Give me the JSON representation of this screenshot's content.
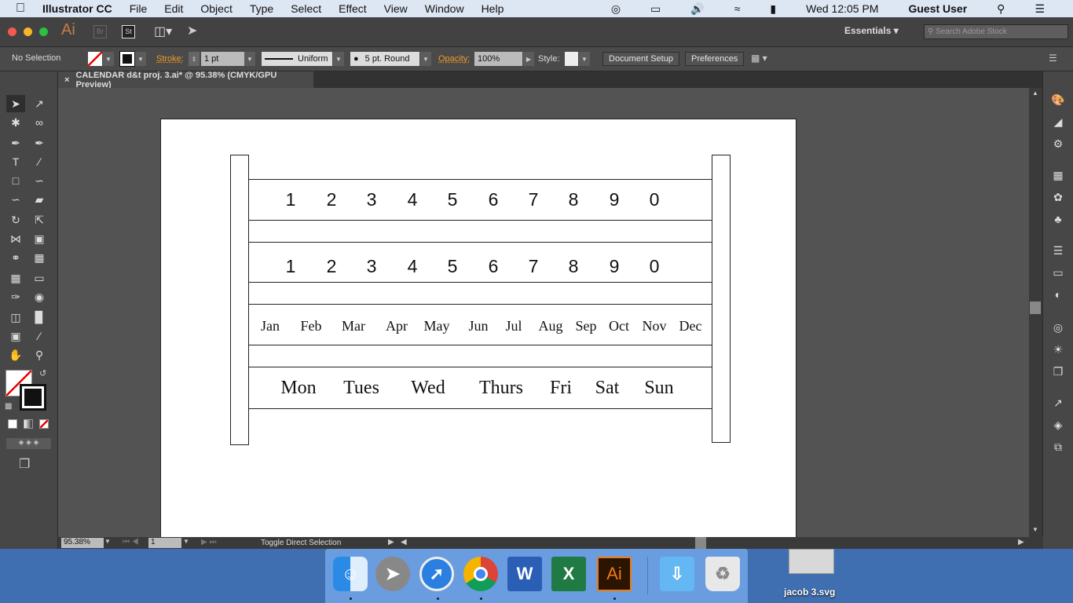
{
  "menubar": {
    "app": "Illustrator CC",
    "items": [
      "File",
      "Edit",
      "Object",
      "Type",
      "Select",
      "Effect",
      "View",
      "Window",
      "Help"
    ],
    "clock": "Wed 12:05 PM",
    "user": "Guest User"
  },
  "appbar": {
    "logo": "Ai",
    "bridge": "Br",
    "stock": "St",
    "workspace": "Essentials",
    "search_placeholder": "Search Adobe Stock"
  },
  "control": {
    "selection": "No Selection",
    "stroke_label": "Stroke:",
    "stroke_value": "1 pt",
    "profile": "Uniform",
    "brush": "5 pt. Round",
    "opacity_label": "Opacity:",
    "opacity_value": "100%",
    "style_label": "Style:",
    "document_setup": "Document Setup",
    "preferences": "Preferences"
  },
  "document": {
    "tab_title": "CALENDAR d&t proj. 3.ai* @ 95.38% (CMYK/GPU Preview)"
  },
  "calendar": {
    "digits_row1": [
      "1",
      "2",
      "3",
      "4",
      "5",
      "6",
      "7",
      "8",
      "9",
      "0"
    ],
    "digits_row2": [
      "1",
      "2",
      "3",
      "4",
      "5",
      "6",
      "7",
      "8",
      "9",
      "0"
    ],
    "months": [
      "Jan",
      "Feb",
      "Mar",
      "Apr",
      "May",
      "Jun",
      "Jul",
      "Aug",
      "Sep",
      "Oct",
      "Nov",
      "Dec"
    ],
    "days": [
      "Mon",
      "Tues",
      "Wed",
      "Thurs",
      "Fri",
      "Sat",
      "Sun"
    ]
  },
  "status": {
    "zoom": "95.38%",
    "artboard": "1",
    "tool_hint": "Toggle Direct Selection"
  },
  "desktop": {
    "file_label": "jacob 3.svg"
  },
  "dock": {
    "apps": [
      "Finder",
      "Launchpad",
      "Safari",
      "Chrome",
      "Word",
      "Excel",
      "Illustrator",
      "Downloads",
      "Trash"
    ]
  }
}
